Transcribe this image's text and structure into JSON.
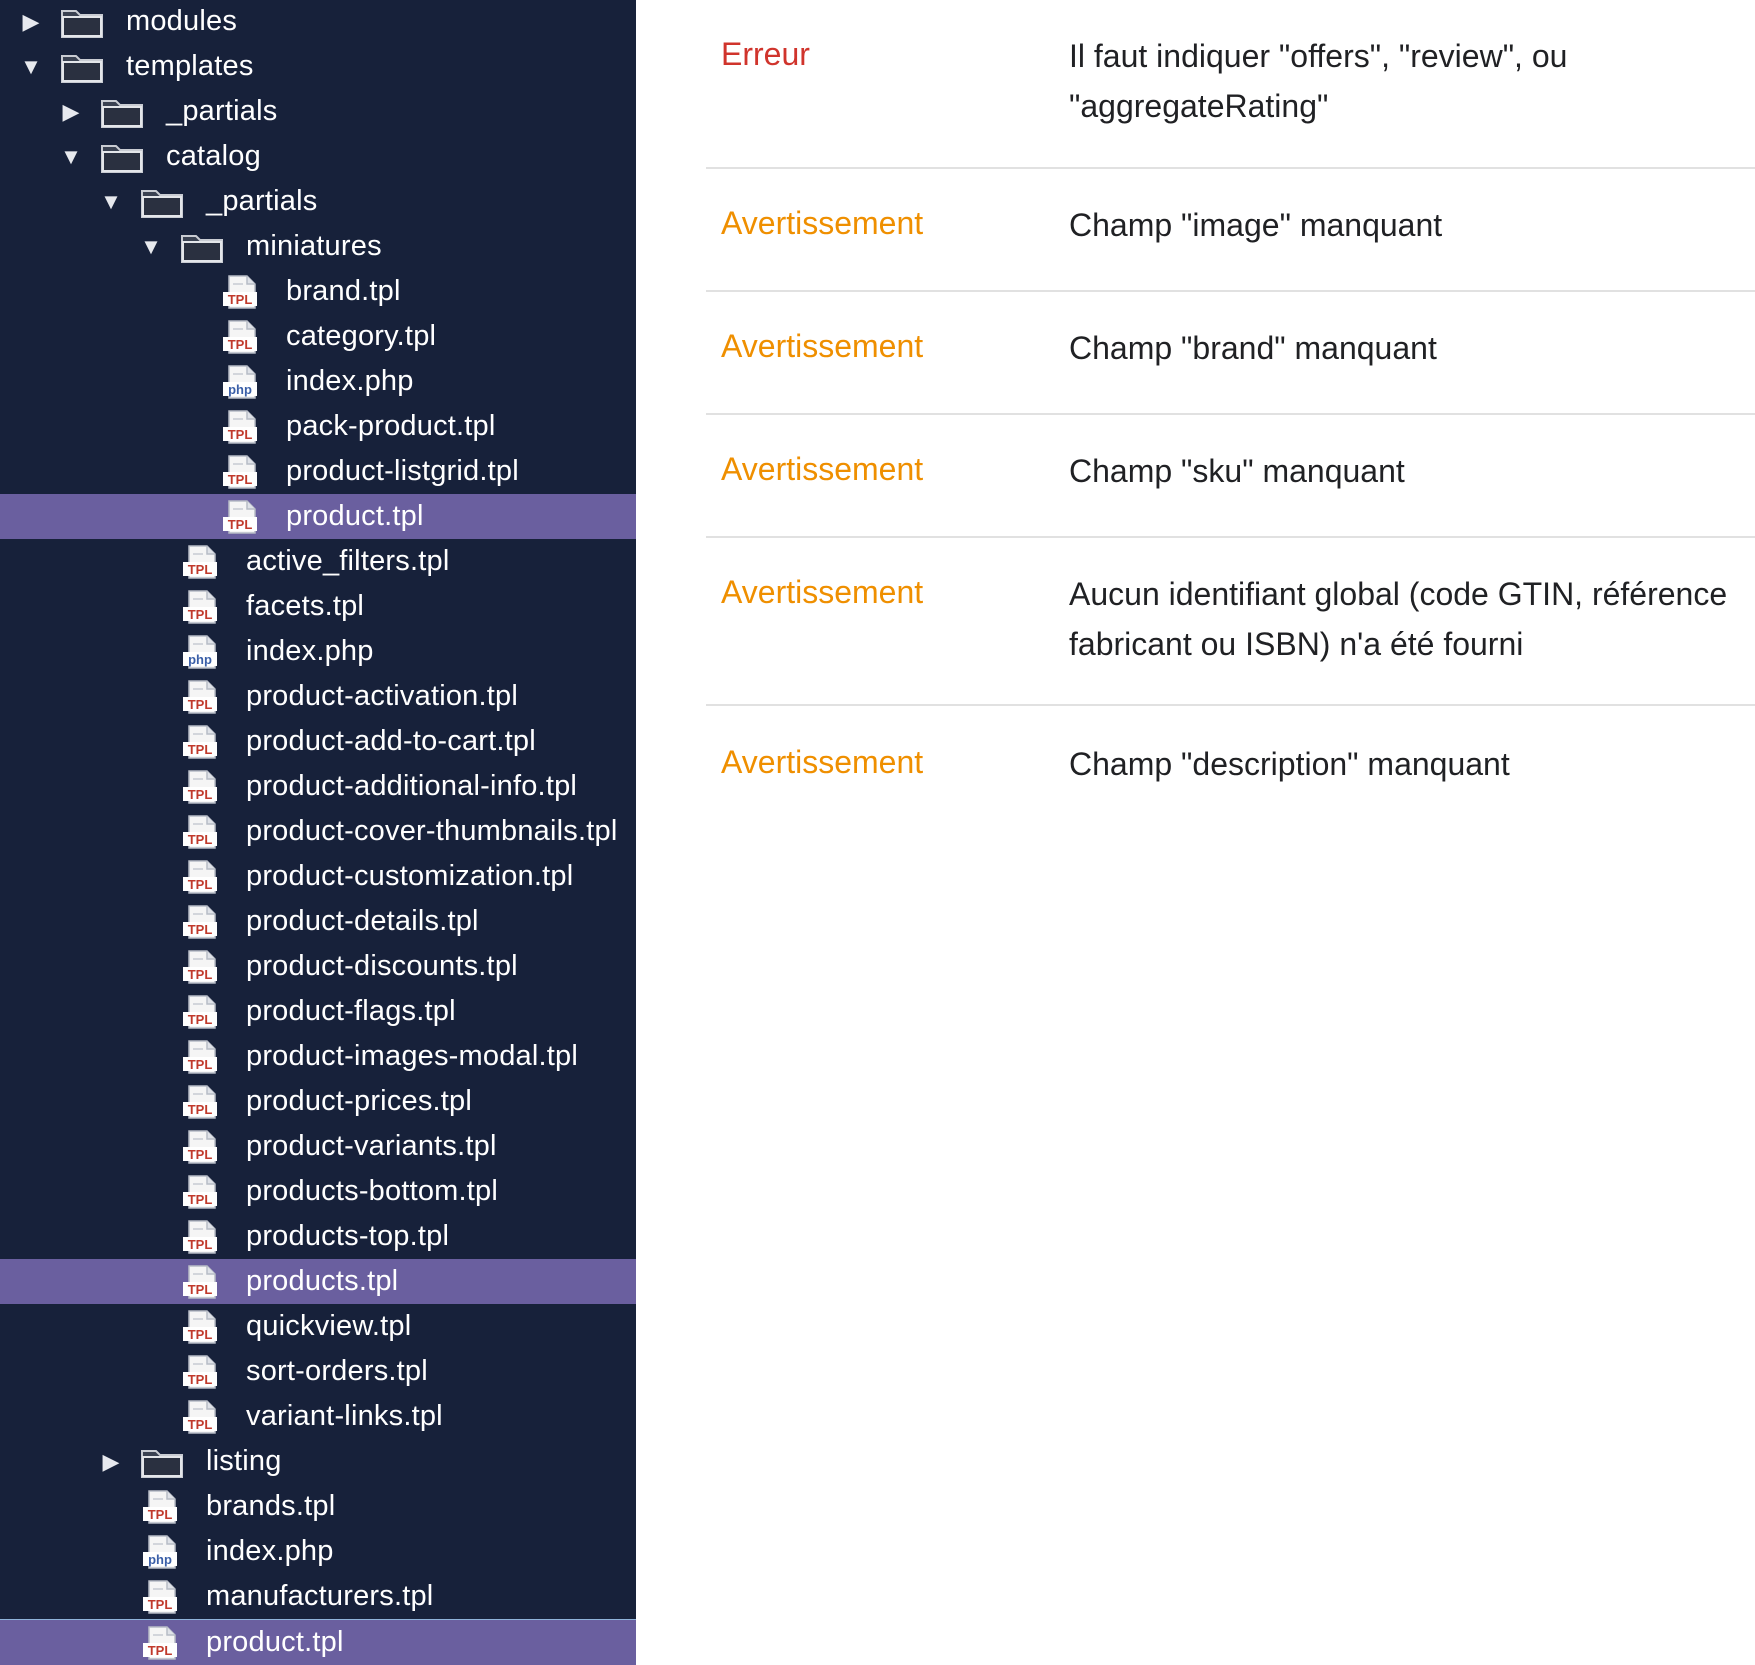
{
  "file_tree": {
    "items": [
      {
        "label": "modules",
        "type": "folder",
        "arrow": "collapsed",
        "depth": 0
      },
      {
        "label": "templates",
        "type": "folder",
        "arrow": "expanded",
        "depth": 0
      },
      {
        "label": "_partials",
        "type": "folder",
        "arrow": "collapsed",
        "depth": 1
      },
      {
        "label": "catalog",
        "type": "folder",
        "arrow": "expanded",
        "depth": 1
      },
      {
        "label": "_partials",
        "type": "folder",
        "arrow": "expanded",
        "depth": 2
      },
      {
        "label": "miniatures",
        "type": "folder",
        "arrow": "expanded",
        "depth": 3
      },
      {
        "label": "brand.tpl",
        "type": "tpl",
        "depth": 4
      },
      {
        "label": "category.tpl",
        "type": "tpl",
        "depth": 4
      },
      {
        "label": "index.php",
        "type": "php",
        "depth": 4
      },
      {
        "label": "pack-product.tpl",
        "type": "tpl",
        "depth": 4
      },
      {
        "label": "product-listgrid.tpl",
        "type": "tpl",
        "depth": 4
      },
      {
        "label": "product.tpl",
        "type": "tpl",
        "depth": 4,
        "selected": true
      },
      {
        "label": "active_filters.tpl",
        "type": "tpl",
        "depth": 3
      },
      {
        "label": "facets.tpl",
        "type": "tpl",
        "depth": 3
      },
      {
        "label": "index.php",
        "type": "php",
        "depth": 3
      },
      {
        "label": "product-activation.tpl",
        "type": "tpl",
        "depth": 3
      },
      {
        "label": "product-add-to-cart.tpl",
        "type": "tpl",
        "depth": 3
      },
      {
        "label": "product-additional-info.tpl",
        "type": "tpl",
        "depth": 3
      },
      {
        "label": "product-cover-thumbnails.tpl",
        "type": "tpl",
        "depth": 3
      },
      {
        "label": "product-customization.tpl",
        "type": "tpl",
        "depth": 3
      },
      {
        "label": "product-details.tpl",
        "type": "tpl",
        "depth": 3
      },
      {
        "label": "product-discounts.tpl",
        "type": "tpl",
        "depth": 3
      },
      {
        "label": "product-flags.tpl",
        "type": "tpl",
        "depth": 3
      },
      {
        "label": "product-images-modal.tpl",
        "type": "tpl",
        "depth": 3
      },
      {
        "label": "product-prices.tpl",
        "type": "tpl",
        "depth": 3
      },
      {
        "label": "product-variants.tpl",
        "type": "tpl",
        "depth": 3
      },
      {
        "label": "products-bottom.tpl",
        "type": "tpl",
        "depth": 3
      },
      {
        "label": "products-top.tpl",
        "type": "tpl",
        "depth": 3
      },
      {
        "label": "products.tpl",
        "type": "tpl",
        "depth": 3,
        "selected": true
      },
      {
        "label": "quickview.tpl",
        "type": "tpl",
        "depth": 3
      },
      {
        "label": "sort-orders.tpl",
        "type": "tpl",
        "depth": 3
      },
      {
        "label": "variant-links.tpl",
        "type": "tpl",
        "depth": 3
      },
      {
        "label": "listing",
        "type": "folder",
        "arrow": "collapsed",
        "depth": 2
      },
      {
        "label": "brands.tpl",
        "type": "tpl",
        "depth": 2
      },
      {
        "label": "index.php",
        "type": "php",
        "depth": 2
      },
      {
        "label": "manufacturers.tpl",
        "type": "tpl",
        "depth": 2
      },
      {
        "label": "product.tpl",
        "type": "tpl",
        "depth": 2,
        "selected": true
      }
    ]
  },
  "results": {
    "items": [
      {
        "level": "Erreur",
        "severity": "error",
        "message": "Il faut indiquer \"offers\", \"review\", ou \"aggregateRating\""
      },
      {
        "level": "Avertissement",
        "severity": "warning",
        "message": "Champ \"image\" manquant"
      },
      {
        "level": "Avertissement",
        "severity": "warning",
        "message": "Champ \"brand\" manquant"
      },
      {
        "level": "Avertissement",
        "severity": "warning",
        "message": "Champ \"sku\" manquant"
      },
      {
        "level": "Avertissement",
        "severity": "warning",
        "message": "Aucun identifiant global (code GTIN, référence fabricant ou ISBN) n'a été fourni"
      },
      {
        "level": "Avertissement",
        "severity": "warning",
        "message": "Champ \"description\" manquant"
      }
    ]
  },
  "colors": {
    "tree_background": "#17213a",
    "selection": "#6a5f9f",
    "error": "#d0342c",
    "warning": "#ef8f00",
    "tpl_icon_text": "#c0392b",
    "php_icon_text": "#3a5fa8"
  },
  "icons": {
    "folder": "folder-icon",
    "tpl": "tpl-file-icon",
    "php": "php-file-icon",
    "expanded": "chevron-down-icon",
    "collapsed": "chevron-right-icon"
  }
}
